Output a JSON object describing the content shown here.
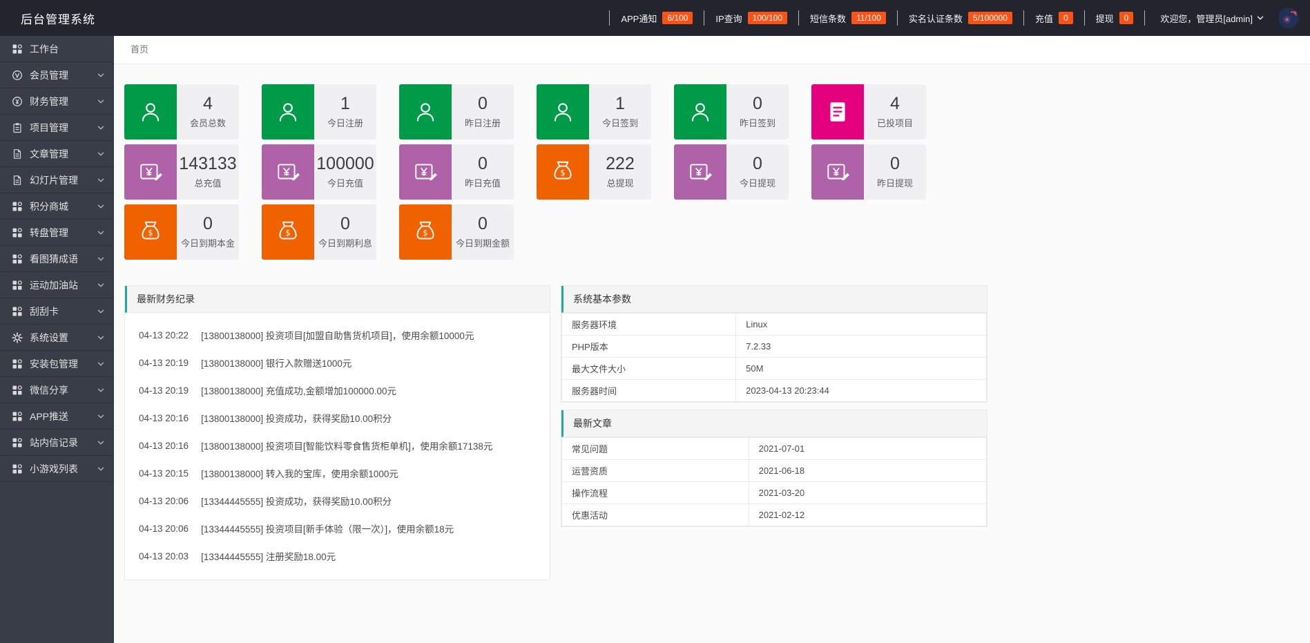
{
  "header": {
    "title": "后台管理系统",
    "quick_stats": [
      {
        "label": "APP通知",
        "value": "6/100"
      },
      {
        "label": "IP查询",
        "value": "100/100"
      },
      {
        "label": "短信条数",
        "value": "11/100"
      },
      {
        "label": "实名认证条数",
        "value": "5/100000"
      },
      {
        "label": "充值",
        "value": "0"
      },
      {
        "label": "提现",
        "value": "0"
      }
    ],
    "badge_color": "#ff5216",
    "welcome_text": "欢迎您，管理员[admin]"
  },
  "sidebar": {
    "items": [
      {
        "id": "workbench",
        "label": "工作台",
        "icon": "grid-icon",
        "expandable": false
      },
      {
        "id": "members",
        "label": "会员管理",
        "icon": "member-icon",
        "expandable": true
      },
      {
        "id": "finance",
        "label": "财务管理",
        "icon": "finance-icon",
        "expandable": true
      },
      {
        "id": "projects",
        "label": "项目管理",
        "icon": "project-icon",
        "expandable": true
      },
      {
        "id": "articles",
        "label": "文章管理",
        "icon": "article-icon",
        "expandable": true
      },
      {
        "id": "slides",
        "label": "幻灯片管理",
        "icon": "article-icon",
        "expandable": true
      },
      {
        "id": "points-mall",
        "label": "积分商城",
        "icon": "grid-icon",
        "expandable": true
      },
      {
        "id": "wheel",
        "label": "转盘管理",
        "icon": "grid-icon",
        "expandable": true
      },
      {
        "id": "idiom-game",
        "label": "看图猜成语",
        "icon": "grid-icon",
        "expandable": true
      },
      {
        "id": "sports",
        "label": "运动加油站",
        "icon": "grid-icon",
        "expandable": true
      },
      {
        "id": "scratch-card",
        "label": "刮刮卡",
        "icon": "grid-icon",
        "expandable": true
      },
      {
        "id": "settings",
        "label": "系统设置",
        "icon": "gear-icon",
        "expandable": true
      },
      {
        "id": "packages",
        "label": "安装包管理",
        "icon": "grid-icon",
        "expandable": true
      },
      {
        "id": "wechat-share",
        "label": "微信分享",
        "icon": "grid-icon",
        "expandable": true
      },
      {
        "id": "app-push",
        "label": "APP推送",
        "icon": "grid-icon",
        "expandable": true
      },
      {
        "id": "messages",
        "label": "站内信记录",
        "icon": "grid-icon",
        "expandable": true
      },
      {
        "id": "mini-games",
        "label": "小游戏列表",
        "icon": "grid-icon",
        "expandable": true
      }
    ]
  },
  "breadcrumb": {
    "home": "首页"
  },
  "stat_cards": {
    "rows": [
      [
        {
          "value": "4",
          "label": "会员总数",
          "color": "#009b48",
          "icon": "user-icon"
        },
        {
          "value": "1",
          "label": "今日注册",
          "color": "#009b48",
          "icon": "user-icon"
        },
        {
          "value": "0",
          "label": "昨日注册",
          "color": "#009b48",
          "icon": "user-icon"
        },
        {
          "value": "1",
          "label": "今日签到",
          "color": "#009b48",
          "icon": "user-icon"
        },
        {
          "value": "0",
          "label": "昨日签到",
          "color": "#009b48",
          "icon": "user-icon"
        },
        {
          "value": "4",
          "label": "已投项目",
          "color": "#e4017e",
          "icon": "list-icon"
        }
      ],
      [
        {
          "value": "143133",
          "label": "总充值",
          "color": "#af62a8",
          "icon": "recharge-icon"
        },
        {
          "value": "100000",
          "label": "今日充值",
          "color": "#af62a8",
          "icon": "recharge-icon"
        },
        {
          "value": "0",
          "label": "昨日充值",
          "color": "#af62a8",
          "icon": "recharge-icon"
        },
        {
          "value": "222",
          "label": "总提现",
          "color": "#f06100",
          "icon": "moneybag-icon"
        },
        {
          "value": "0",
          "label": "今日提现",
          "color": "#af62a8",
          "icon": "recharge-icon"
        },
        {
          "value": "0",
          "label": "昨日提现",
          "color": "#af62a8",
          "icon": "recharge-icon"
        }
      ],
      [
        {
          "value": "0",
          "label": "今日到期本金",
          "color": "#f06100",
          "icon": "moneybag-icon"
        },
        {
          "value": "0",
          "label": "今日到期利息",
          "color": "#f06100",
          "icon": "moneybag-icon"
        },
        {
          "value": "0",
          "label": "今日到期金额",
          "color": "#f06100",
          "icon": "moneybag-icon"
        }
      ]
    ]
  },
  "finance_panel": {
    "title": "最新财务纪录",
    "records": [
      {
        "time": "04-13 20:22",
        "text": "[13800138000] 投资项目[加盟自助售货机项目]，使用余额10000元"
      },
      {
        "time": "04-13 20:19",
        "text": "[13800138000] 银行入款赠送1000元"
      },
      {
        "time": "04-13 20:19",
        "text": "[13800138000] 充值成功,金额增加100000.00元"
      },
      {
        "time": "04-13 20:16",
        "text": "[13800138000] 投资成功，获得奖励10.00积分"
      },
      {
        "time": "04-13 20:16",
        "text": "[13800138000] 投资项目[智能饮料零食售货柜单机]，使用余额17138元"
      },
      {
        "time": "04-13 20:15",
        "text": "[13800138000] 转入我的宝库，使用余额1000元"
      },
      {
        "time": "04-13 20:06",
        "text": "[13344445555] 投资成功，获得奖励10.00积分"
      },
      {
        "time": "04-13 20:06",
        "text": "[13344445555] 投资项目[新手体验（限一次）]，使用余额18元"
      },
      {
        "time": "04-13 20:03",
        "text": "[13344445555] 注册奖励18.00元"
      }
    ]
  },
  "system_panel": {
    "title": "系统基本参数",
    "rows": [
      {
        "label": "服务器环境",
        "value": "Linux"
      },
      {
        "label": "PHP版本",
        "value": "7.2.33"
      },
      {
        "label": "最大文件大小",
        "value": "50M"
      },
      {
        "label": "服务器时间",
        "value": "2023-04-13 20:23:44"
      }
    ]
  },
  "articles_panel": {
    "title": "最新文章",
    "rows": [
      {
        "label": "常见问题",
        "value": "2021-07-01"
      },
      {
        "label": "运营资质",
        "value": "2021-06-18"
      },
      {
        "label": "操作流程",
        "value": "2021-03-20"
      },
      {
        "label": "优惠活动",
        "value": "2021-02-12"
      }
    ]
  },
  "accent_color": "#27a69a"
}
